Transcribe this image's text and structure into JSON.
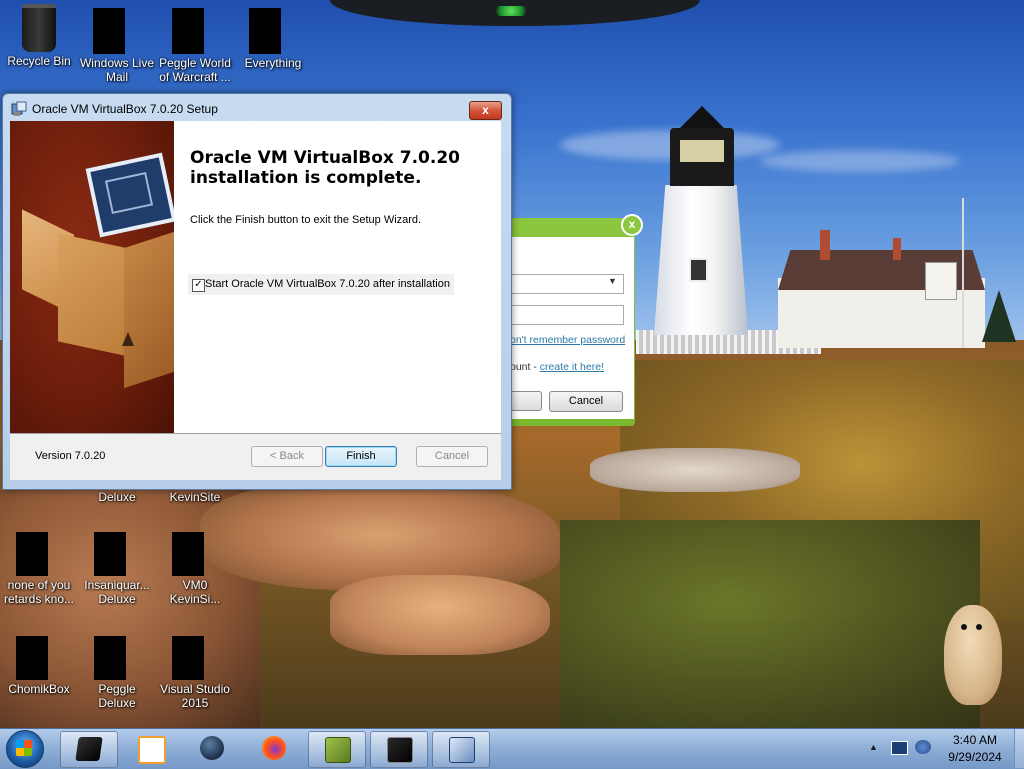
{
  "desktop": {
    "icons": [
      {
        "label": "Recycle Bin"
      },
      {
        "label": "Windows Live Mail"
      },
      {
        "label": "Peggle World of Warcraft ..."
      },
      {
        "label": "Everything"
      },
      {
        "label": "Deluxe"
      },
      {
        "label": "KevinSite"
      },
      {
        "label": "none of you retards kno..."
      },
      {
        "label": "Insaniquar... Deluxe"
      },
      {
        "label": "VM0 KevinSi..."
      },
      {
        "label": "ChomikBox"
      },
      {
        "label": "Peggle Deluxe"
      },
      {
        "label": "Visual Studio 2015"
      }
    ]
  },
  "background_window": {
    "forgot_text": "on't remember password",
    "account_prefix": "ount - ",
    "account_link": "create it here!",
    "cancel_label": "Cancel",
    "close_glyph": "x"
  },
  "setup": {
    "title": "Oracle VM VirtualBox 7.0.20 Setup",
    "close_glyph": "x",
    "heading": "Oracle VM VirtualBox 7.0.20 installation is complete.",
    "description": "Click the Finish button to exit the Setup Wizard.",
    "checkbox_label": "Start Oracle VM VirtualBox 7.0.20 after installation",
    "checkbox_checked": true,
    "version": "Version 7.0.20",
    "buttons": {
      "back": "< Back",
      "finish": "Finish",
      "cancel": "Cancel"
    }
  },
  "taskbar": {
    "items": [
      {
        "icon": "dark-app-icon"
      },
      {
        "icon": "media-player-icon"
      },
      {
        "icon": "globe-icon"
      },
      {
        "icon": "firefox-icon"
      },
      {
        "icon": "chomikbox-icon"
      },
      {
        "icon": "monitor-app-icon"
      },
      {
        "icon": "installer-icon"
      }
    ],
    "clock_time": "3:40 AM",
    "clock_date": "9/29/2024"
  }
}
